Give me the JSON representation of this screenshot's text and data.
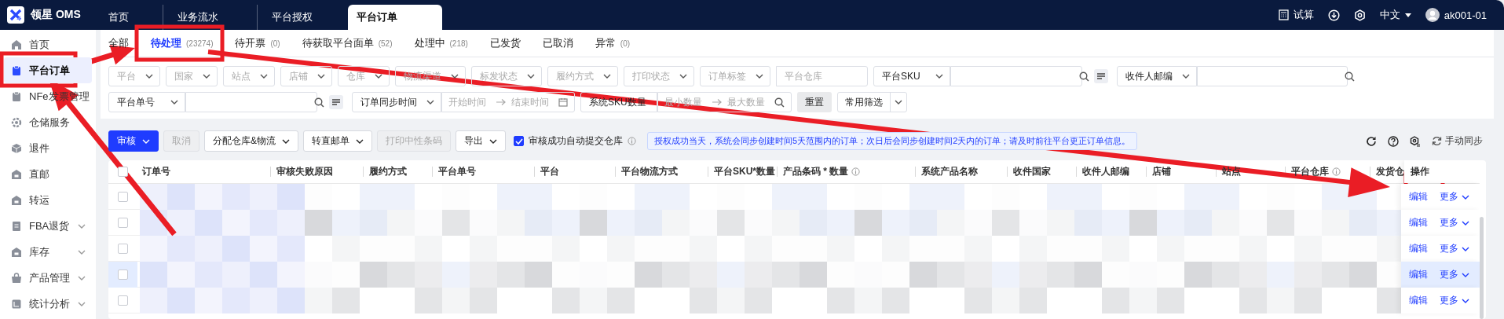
{
  "top_bar": {
    "logo": "领星 OMS",
    "tabs": [
      {
        "label": "首页",
        "selected": false
      },
      {
        "label": "业务流水",
        "selected": false
      },
      {
        "label": "平台授权",
        "selected": false
      },
      {
        "label": "平台订单",
        "selected": true
      }
    ],
    "actions": [
      {
        "kind": "calculator",
        "label": "试算"
      },
      {
        "kind": "download"
      },
      {
        "kind": "settings"
      },
      {
        "kind": "language",
        "label": "中文"
      },
      {
        "kind": "user",
        "label": "ak001-01"
      }
    ]
  },
  "sidebar": {
    "items": [
      {
        "kind": "home",
        "label": "首页",
        "selected": false,
        "expandable": false
      },
      {
        "kind": "clipboard",
        "label": "平台订单",
        "selected": true,
        "expandable": false
      },
      {
        "kind": "clipboard",
        "label": "NFe发票管理",
        "selected": false,
        "expandable": false
      },
      {
        "kind": "gear",
        "label": "仓储服务",
        "selected": false,
        "expandable": false
      },
      {
        "kind": "box",
        "label": "退件",
        "selected": false,
        "expandable": false
      },
      {
        "kind": "house",
        "label": "直邮",
        "selected": false,
        "expandable": false
      },
      {
        "kind": "house",
        "label": "转运",
        "selected": false,
        "expandable": false
      },
      {
        "kind": "document",
        "label": "FBA退货",
        "selected": false,
        "expandable": true
      },
      {
        "kind": "house",
        "label": "库存",
        "selected": false,
        "expandable": true
      },
      {
        "kind": "bag",
        "label": "产品管理",
        "selected": false,
        "expandable": true
      },
      {
        "kind": "chart",
        "label": "统计分析",
        "selected": false,
        "expandable": true
      }
    ]
  },
  "status_tabs": [
    {
      "label": "全部",
      "selected": false
    },
    {
      "label": "待处理",
      "count": "(23274)",
      "selected": true
    },
    {
      "label": "待开票",
      "count": "(0)",
      "selected": false
    },
    {
      "label": "待获取平台面单",
      "count": "(52)",
      "selected": false
    },
    {
      "label": "处理中",
      "count": "(218)",
      "selected": false
    },
    {
      "label": "已发货",
      "selected": false
    },
    {
      "label": "已取消",
      "selected": false
    },
    {
      "label": "异常",
      "count": "(0)",
      "selected": false
    }
  ],
  "filters": [
    [
      {
        "kind": "select",
        "placeholder": "平台"
      },
      {
        "kind": "select",
        "placeholder": "国家"
      },
      {
        "kind": "select",
        "placeholder": "站点"
      },
      {
        "kind": "select",
        "placeholder": "店铺"
      },
      {
        "kind": "select",
        "placeholder": "仓库"
      },
      {
        "kind": "select",
        "placeholder": "物流渠道"
      },
      {
        "kind": "select",
        "placeholder": "标发状态"
      },
      {
        "kind": "select",
        "placeholder": "履约方式"
      },
      {
        "kind": "select",
        "placeholder": "打印状态"
      },
      {
        "kind": "select",
        "placeholder": "订单标签"
      },
      {
        "kind": "input",
        "placeholder": "平台仓库"
      },
      {
        "kind": "select",
        "value": "平台SKU"
      },
      {
        "kind": "input",
        "search": true,
        "list": true
      },
      {
        "kind": "select",
        "value": "收件人邮编"
      },
      {
        "kind": "input",
        "search": true
      }
    ],
    [
      {
        "kind": "select",
        "value": "平台单号"
      },
      {
        "kind": "input",
        "search": true,
        "list": true
      },
      {
        "kind": "select",
        "value": "订单同步时间"
      },
      {
        "kind": "date-range",
        "fields": [
          {
            "placeholder": "开始时间"
          },
          {
            "placeholder": "结束时间"
          }
        ]
      },
      {
        "kind": "select",
        "value": "系统SKU数量",
        "chevron": false
      },
      {
        "kind": "number-range",
        "fields": [
          {
            "placeholder": "最小数量"
          },
          {
            "placeholder": "最大数量"
          }
        ]
      },
      {
        "kind": "button",
        "label": "重置"
      },
      {
        "kind": "split",
        "label": "常用筛选"
      }
    ]
  ],
  "toolbar": {
    "buttons": [
      {
        "label": "审核",
        "primary": true,
        "disabled": false,
        "dropdown": true
      },
      {
        "label": "取消",
        "primary": false,
        "disabled": true,
        "dropdown": false
      },
      {
        "label": "分配仓库&物流",
        "primary": false,
        "disabled": false,
        "dropdown": true
      },
      {
        "label": "转直邮单",
        "primary": false,
        "disabled": false,
        "dropdown": true
      },
      {
        "label": "打印中性条码",
        "primary": false,
        "disabled": true,
        "dropdown": false
      },
      {
        "label": "导出",
        "primary": false,
        "disabled": false,
        "dropdown": true
      }
    ],
    "auto_submit": {
      "label": "审核成功自动提交仓库",
      "checked": true
    },
    "notice": "授权成功当天，系统会同步创建时间5天范围内的订单；次日后会同步创建时间2天内的订单；请及时前往平台更正订单信息。",
    "tools": [
      {
        "kind": "refresh"
      },
      {
        "kind": "help"
      },
      {
        "kind": "column-settings"
      },
      {
        "kind": "sync",
        "label": "手动同步"
      }
    ]
  },
  "table": {
    "select_all_checked": false,
    "columns": [
      {
        "label": "订单号"
      },
      {
        "label": "审核失败原因"
      },
      {
        "label": "履约方式"
      },
      {
        "label": "平台单号"
      },
      {
        "label": "平台"
      },
      {
        "label": "平台物流方式"
      },
      {
        "label": "平台SKU*数量"
      },
      {
        "label": "产品条码 * 数量",
        "info": true
      },
      {
        "label": "系统产品名称"
      },
      {
        "label": "收件国家"
      },
      {
        "label": "收件人邮编"
      },
      {
        "label": "店铺"
      },
      {
        "label": "站点"
      },
      {
        "label": "平台仓库",
        "info": true
      },
      {
        "label": "发货仓"
      },
      {
        "label": "操作"
      }
    ],
    "rows": [
      {
        "checked": false,
        "hovered": false,
        "actions": [
          {
            "kind": "link",
            "label": "编辑"
          },
          {
            "kind": "dropdown",
            "label": "更多"
          }
        ]
      },
      {
        "checked": false,
        "hovered": false,
        "actions": [
          {
            "kind": "link",
            "label": "编辑"
          },
          {
            "kind": "dropdown",
            "label": "更多"
          }
        ]
      },
      {
        "checked": false,
        "hovered": false,
        "actions": [
          {
            "kind": "link",
            "label": "编辑"
          },
          {
            "kind": "dropdown",
            "label": "更多"
          }
        ]
      },
      {
        "checked": false,
        "hovered": true,
        "actions": [
          {
            "kind": "link",
            "label": "编辑"
          },
          {
            "kind": "dropdown",
            "label": "更多"
          }
        ]
      },
      {
        "checked": false,
        "hovered": false,
        "actions": [
          {
            "kind": "link",
            "label": "编辑"
          },
          {
            "kind": "dropdown",
            "label": "更多"
          }
        ]
      }
    ]
  },
  "annotations": [
    {
      "kind": "box"
    },
    {
      "kind": "box"
    },
    {
      "kind": "box"
    },
    {
      "kind": "arrow"
    },
    {
      "kind": "arrow"
    },
    {
      "kind": "arrow"
    }
  ]
}
